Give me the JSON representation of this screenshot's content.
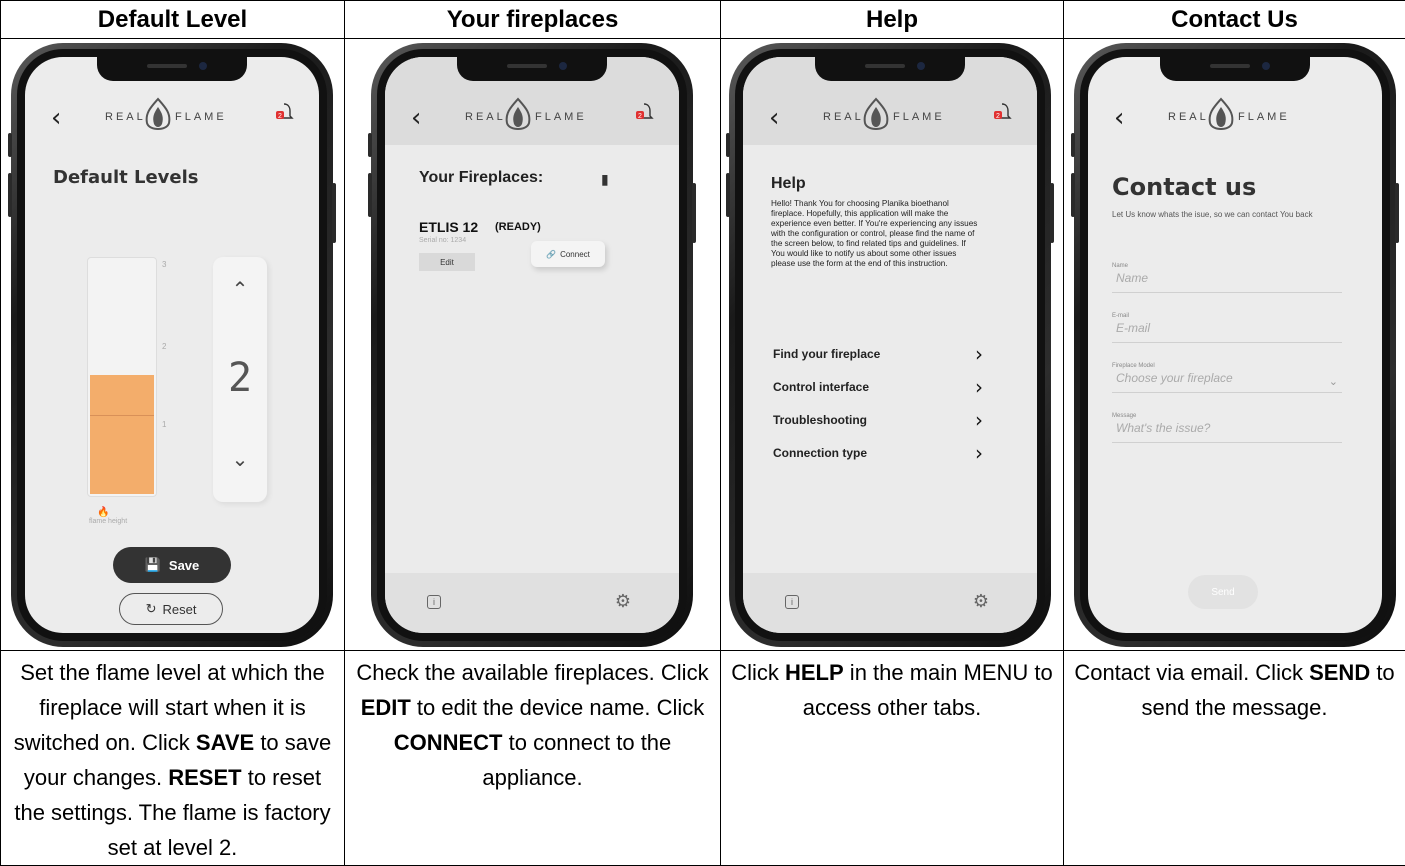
{
  "headers": [
    "Default Level",
    "Your fireplaces",
    "Help",
    "Contact Us"
  ],
  "app": {
    "logo_left": "REAL",
    "logo_right": "FLAME",
    "notif_count": "2"
  },
  "default_levels": {
    "title": "Default Levels",
    "value": "2",
    "level_fraction": 0.5,
    "ticks": [
      "3",
      "2",
      "1"
    ],
    "flame_label": "flame height",
    "save_label": "Save",
    "reset_label": "Reset"
  },
  "fireplaces": {
    "title": "Your Fireplaces:",
    "name": "ETLIS 12",
    "status": "(READY)",
    "serial": "Serial no: 1234",
    "edit_label": "Edit",
    "connect_label": "Connect"
  },
  "help": {
    "title": "Help",
    "body": "Hello! Thank You for choosing Planika bioethanol fireplace. Hopefully, this application will make the experience even better. If You're experiencing any issues with the configuration or control, please find the name of the screen below, to find related tips and guidelines. If You would like to notify us about some other issues please use the form at the end of this instruction.",
    "items": [
      "Find your fireplace",
      "Control interface",
      "Troubleshooting",
      "Connection type"
    ]
  },
  "contact": {
    "title": "Contact us",
    "subtitle": "Let Us know whats the isue, so we can contact You back",
    "fields": [
      {
        "label": "Name",
        "placeholder": "Name"
      },
      {
        "label": "E-mail",
        "placeholder": "E-mail"
      },
      {
        "label": "Fireplace Model",
        "placeholder": "Choose your fireplace"
      },
      {
        "label": "Message",
        "placeholder": "What's the issue?"
      }
    ],
    "send_label": "Send"
  },
  "descriptions": {
    "col1": {
      "a": "Set the flame level at which the fireplace will start when it is switched on. Click ",
      "b1": "SAVE",
      "c": " to save your changes. ",
      "b2": "RESET",
      "d": " to reset the settings. The flame is factory set at level 2."
    },
    "col2": {
      "a": "Check the available fireplaces. Click ",
      "b1": "EDIT",
      "c": " to edit the device name. Click ",
      "b2": "CONNECT",
      "d": " to connect to the appliance."
    },
    "col3": {
      "a": "Click ",
      "b1": "HELP",
      "c": " in the main MENU to access other tabs."
    },
    "col4": {
      "a": "Contact   via email. Click ",
      "b1": "SEND",
      "c": " to send the message."
    }
  },
  "colors": {
    "flame_fill": "#f3ad6b",
    "logo_flame": "#555555",
    "badge": "#e03131"
  }
}
